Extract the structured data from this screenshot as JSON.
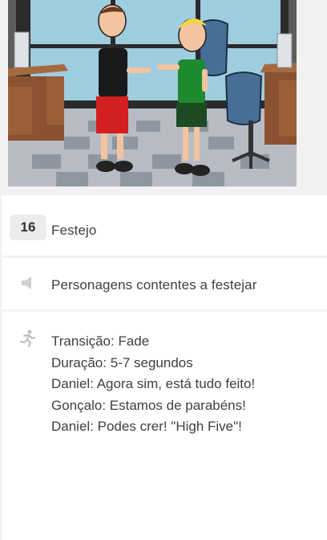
{
  "scene": {
    "description_icon": "storyboard-image"
  },
  "cell": {
    "number": "16",
    "title": "Festejo"
  },
  "audio": {
    "icon": "speaker-icon",
    "text": "Personagens contentes a festejar"
  },
  "notes": {
    "icon": "running-figure-icon",
    "lines": [
      "Transição: Fade",
      "Duração: 5-7 segundos",
      "Daniel: Agora sim, está tudo feito!",
      "Gonçalo: Estamos de parabéns!",
      "Daniel: Podes crer! \"High Five\"!"
    ]
  },
  "colors": {
    "page_bg": "#f2f2f2",
    "card_bg": "#ffffff",
    "badge_bg": "#ececec",
    "text": "#3f3f3f"
  }
}
